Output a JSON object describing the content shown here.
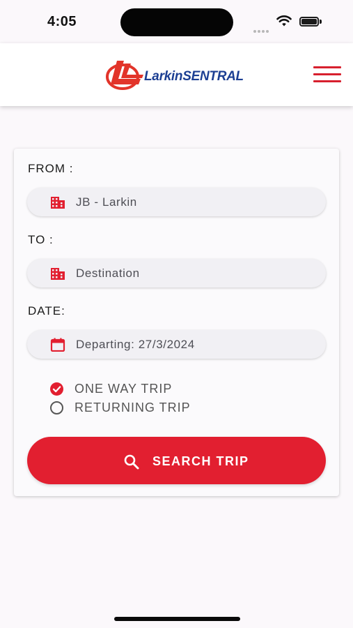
{
  "status_bar": {
    "time": "4:05",
    "icons": [
      "signal-icon",
      "wifi-icon",
      "battery-icon"
    ],
    "battery_level": 1.0
  },
  "header": {
    "logo_text": "LarkinSENTRAL",
    "menu_icon": "hamburger-menu-icon"
  },
  "colors": {
    "accent": "#e21f30",
    "brand_blue": "#1c3f93",
    "background": "#fbf8fb"
  },
  "search_form": {
    "from": {
      "label": "FROM :",
      "value": "JB - Larkin",
      "icon": "building-icon"
    },
    "to": {
      "label": "TO :",
      "placeholder": "Destination",
      "icon": "building-icon"
    },
    "date": {
      "label": "DATE:",
      "value": "Departing: 27/3/2024",
      "icon": "calendar-icon"
    },
    "trip_type": {
      "options": [
        {
          "label": "ONE WAY TRIP",
          "selected": true
        },
        {
          "label": "RETURNING TRIP",
          "selected": false
        }
      ]
    },
    "search_button": {
      "label": "SEARCH TRIP",
      "icon": "search-icon"
    }
  }
}
